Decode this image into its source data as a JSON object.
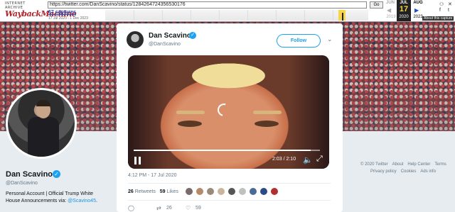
{
  "wayback": {
    "logo_top": "INTERNET ARCHIVE",
    "logo_main": "WaybackMachine",
    "url": "https://twitter.com/DanScavino/status/1284264724356530176",
    "go_label": "Go",
    "captures": "67 captures",
    "range": "17 Jul 2020 - 1 Dec 2023",
    "months": [
      "JUN",
      "JUL",
      "AUG"
    ],
    "day": "17",
    "years": [
      "2019",
      "2020",
      "2023"
    ],
    "about": "About this capture"
  },
  "profile": {
    "name": "Dan Scavino",
    "handle": "@DanScavino",
    "bio_line1": "Personal Account | Official Trump White",
    "bio_line2_text": "House Announcements via: ",
    "bio_line2_link": "@Scavino45",
    "bio_line2_end": "."
  },
  "footer": {
    "row1": [
      "© 2020 Twitter",
      "About",
      "Help Center",
      "Terms"
    ],
    "row2": [
      "Privacy policy",
      "Cookies",
      "Ads info"
    ]
  },
  "tweet": {
    "name": "Dan Scavino",
    "handle": "@DanScavino",
    "follow_label": "Follow",
    "video_time": "2:03 / 2:10",
    "video_progress": 0.95,
    "timestamp": "4:12 PM - 17 Jul 2020",
    "retweets_count": "26",
    "retweets_label": "Retweets",
    "likes_count": "59",
    "likes_label": "Likes",
    "retweet_action_count": "26",
    "like_action_count": "59",
    "liker_colors": [
      "#7a6a6a",
      "#b58a6a",
      "#9a8a7a",
      "#c9b59a",
      "#555555",
      "#c0c0c0",
      "#4a6a9a",
      "#2a4a8a",
      "#b03030"
    ]
  },
  "colors": {
    "twitter_blue": "#1da1f2",
    "wayback_red": "#b5212a",
    "page_bg": "#e6ecf0"
  }
}
